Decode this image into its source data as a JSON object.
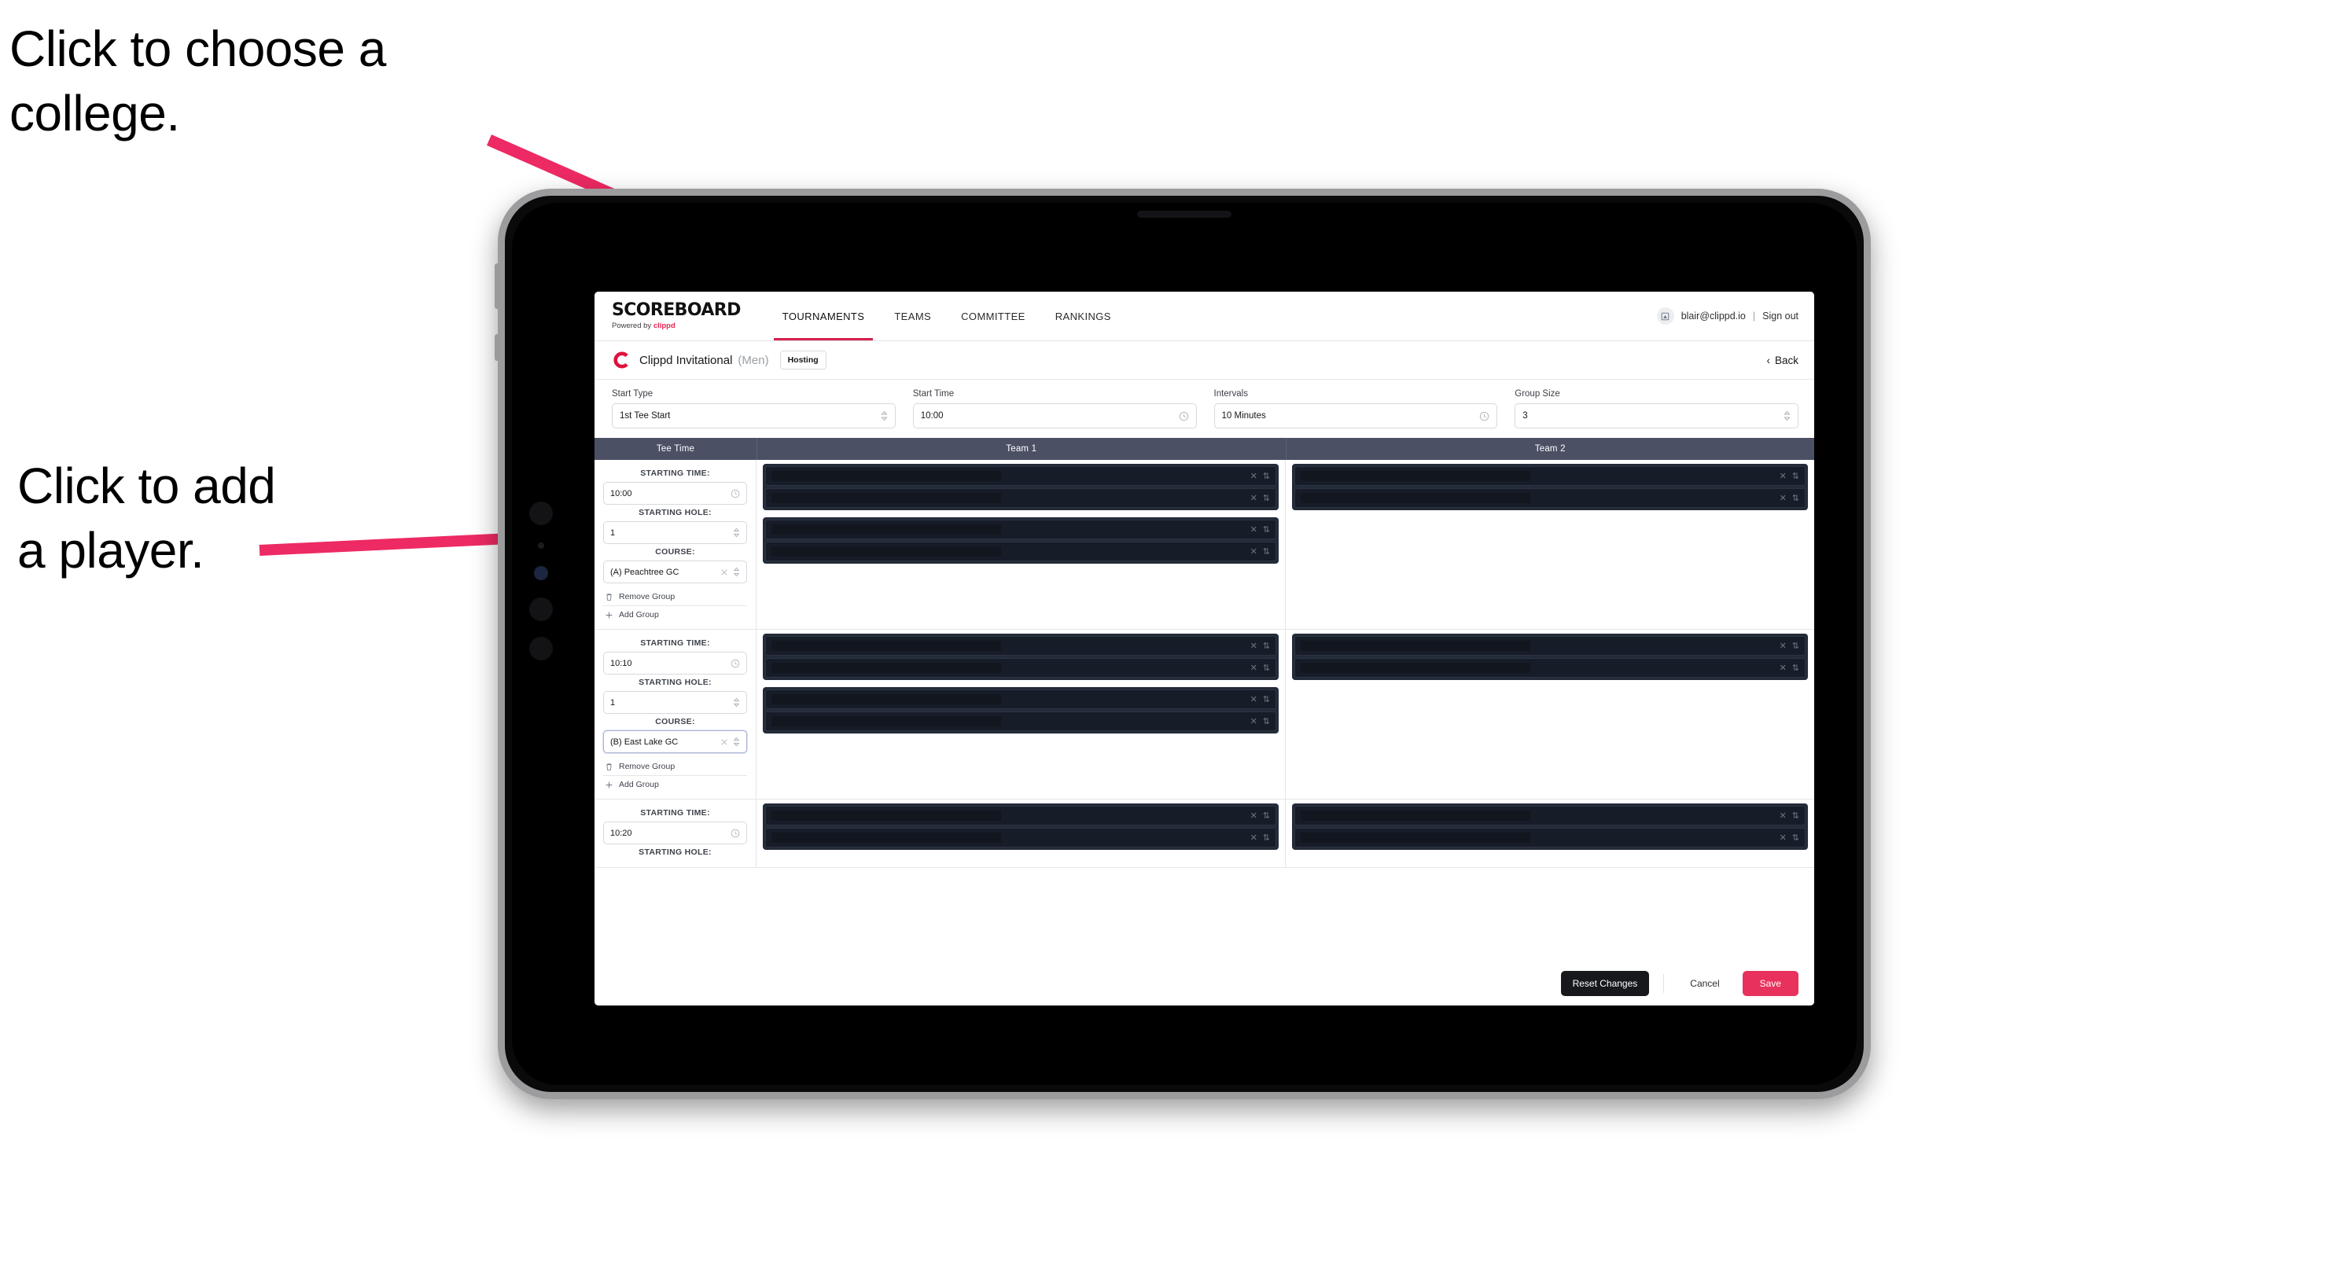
{
  "annotations": {
    "choose_college": "Click to choose a\ncollege.",
    "add_player": "Click to add\na player.",
    "arrow_color": "#ED2A63"
  },
  "colors": {
    "accent_pink": "#D3204D",
    "save_pink": "#E8315C",
    "table_header_bg": "#4B5065",
    "slot_dark": "#232A38",
    "dark_button": "#17181C"
  },
  "topnav": {
    "logo_main": "SCOREBOARD",
    "logo_sub_prefix": "Powered by ",
    "logo_sub_brand": "clippd",
    "tabs": [
      {
        "label": "TOURNAMENTS",
        "active": true
      },
      {
        "label": "TEAMS",
        "active": false
      },
      {
        "label": "COMMITTEE",
        "active": false
      },
      {
        "label": "RANKINGS",
        "active": false
      }
    ],
    "user_email": "blair@clippd.io",
    "separator": "|",
    "sign_out": "Sign out"
  },
  "subheader": {
    "logo_letter": "C",
    "tournament_name": "Clippd Invitational",
    "gender": "(Men)",
    "status_badge": "Hosting",
    "back_label": "Back",
    "back_chevron": "‹"
  },
  "settings": {
    "fields": [
      {
        "label": "Start Type",
        "value": "1st Tee Start",
        "icon": "stepper-icon"
      },
      {
        "label": "Start Time",
        "value": "10:00",
        "icon": "clock-icon"
      },
      {
        "label": "Intervals",
        "value": "10 Minutes",
        "icon": "clock-icon"
      },
      {
        "label": "Group Size",
        "value": "3",
        "icon": "stepper-icon"
      }
    ]
  },
  "table": {
    "headers": {
      "tee_time": "Tee Time",
      "team1": "Team 1",
      "team2": "Team 2"
    },
    "labels": {
      "starting_time": "STARTING TIME:",
      "starting_hole": "STARTING HOLE:",
      "course": "COURSE:",
      "remove_group": "Remove Group",
      "add_group": "Add Group"
    },
    "groups": [
      {
        "starting_time": "10:00",
        "starting_hole": "1",
        "course": "(A) Peachtree GC",
        "course_focused": false,
        "team1_blocks": [
          2,
          2
        ],
        "team2_blocks": [
          2
        ]
      },
      {
        "starting_time": "10:10",
        "starting_hole": "1",
        "course": "(B) East Lake GC",
        "course_focused": true,
        "team1_blocks": [
          2,
          2
        ],
        "team2_blocks": [
          2
        ]
      },
      {
        "starting_time": "10:20",
        "starting_hole": "",
        "course": "",
        "course_focused": false,
        "team1_blocks": [
          2
        ],
        "team2_blocks": [
          2
        ]
      }
    ]
  },
  "footer": {
    "reset_label": "Reset Changes",
    "cancel_label": "Cancel",
    "save_label": "Save"
  }
}
